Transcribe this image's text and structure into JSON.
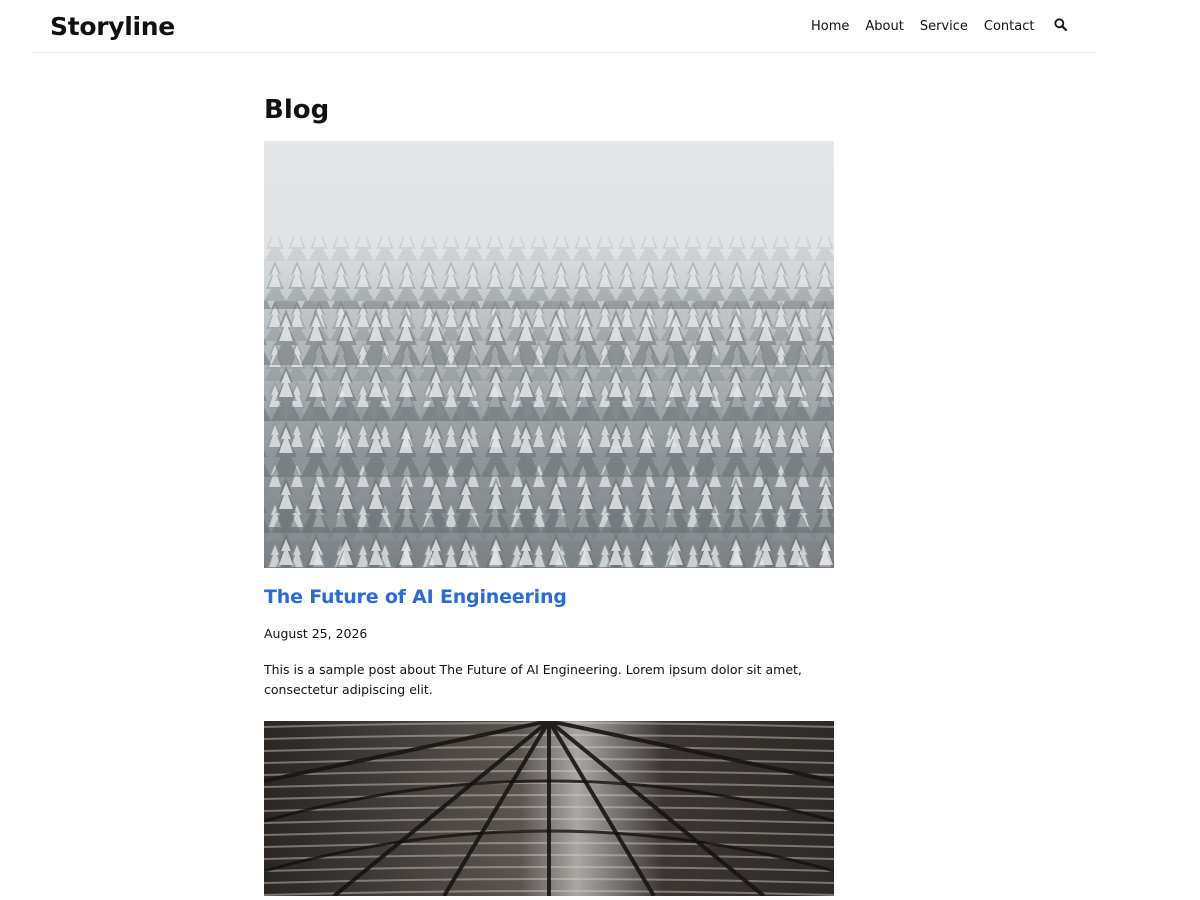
{
  "site": {
    "logo": "Storyline"
  },
  "nav": {
    "items": [
      {
        "label": "Home"
      },
      {
        "label": "About"
      },
      {
        "label": "Service"
      },
      {
        "label": "Contact"
      }
    ],
    "search_icon": "search-icon"
  },
  "page": {
    "title": "Blog"
  },
  "posts": [
    {
      "title": "The Future of AI Engineering",
      "date": "August 25, 2026",
      "excerpt": "This is a sample post about The Future of AI Engineering. Lorem ipsum dolor sit amet, consectetur adipiscing elit.",
      "image": "snowy-forest-photo"
    },
    {
      "image": "industrial-roof-photo"
    }
  ],
  "colors": {
    "accent": "#2b6ad9",
    "text": "#111111",
    "border": "#ececec"
  }
}
